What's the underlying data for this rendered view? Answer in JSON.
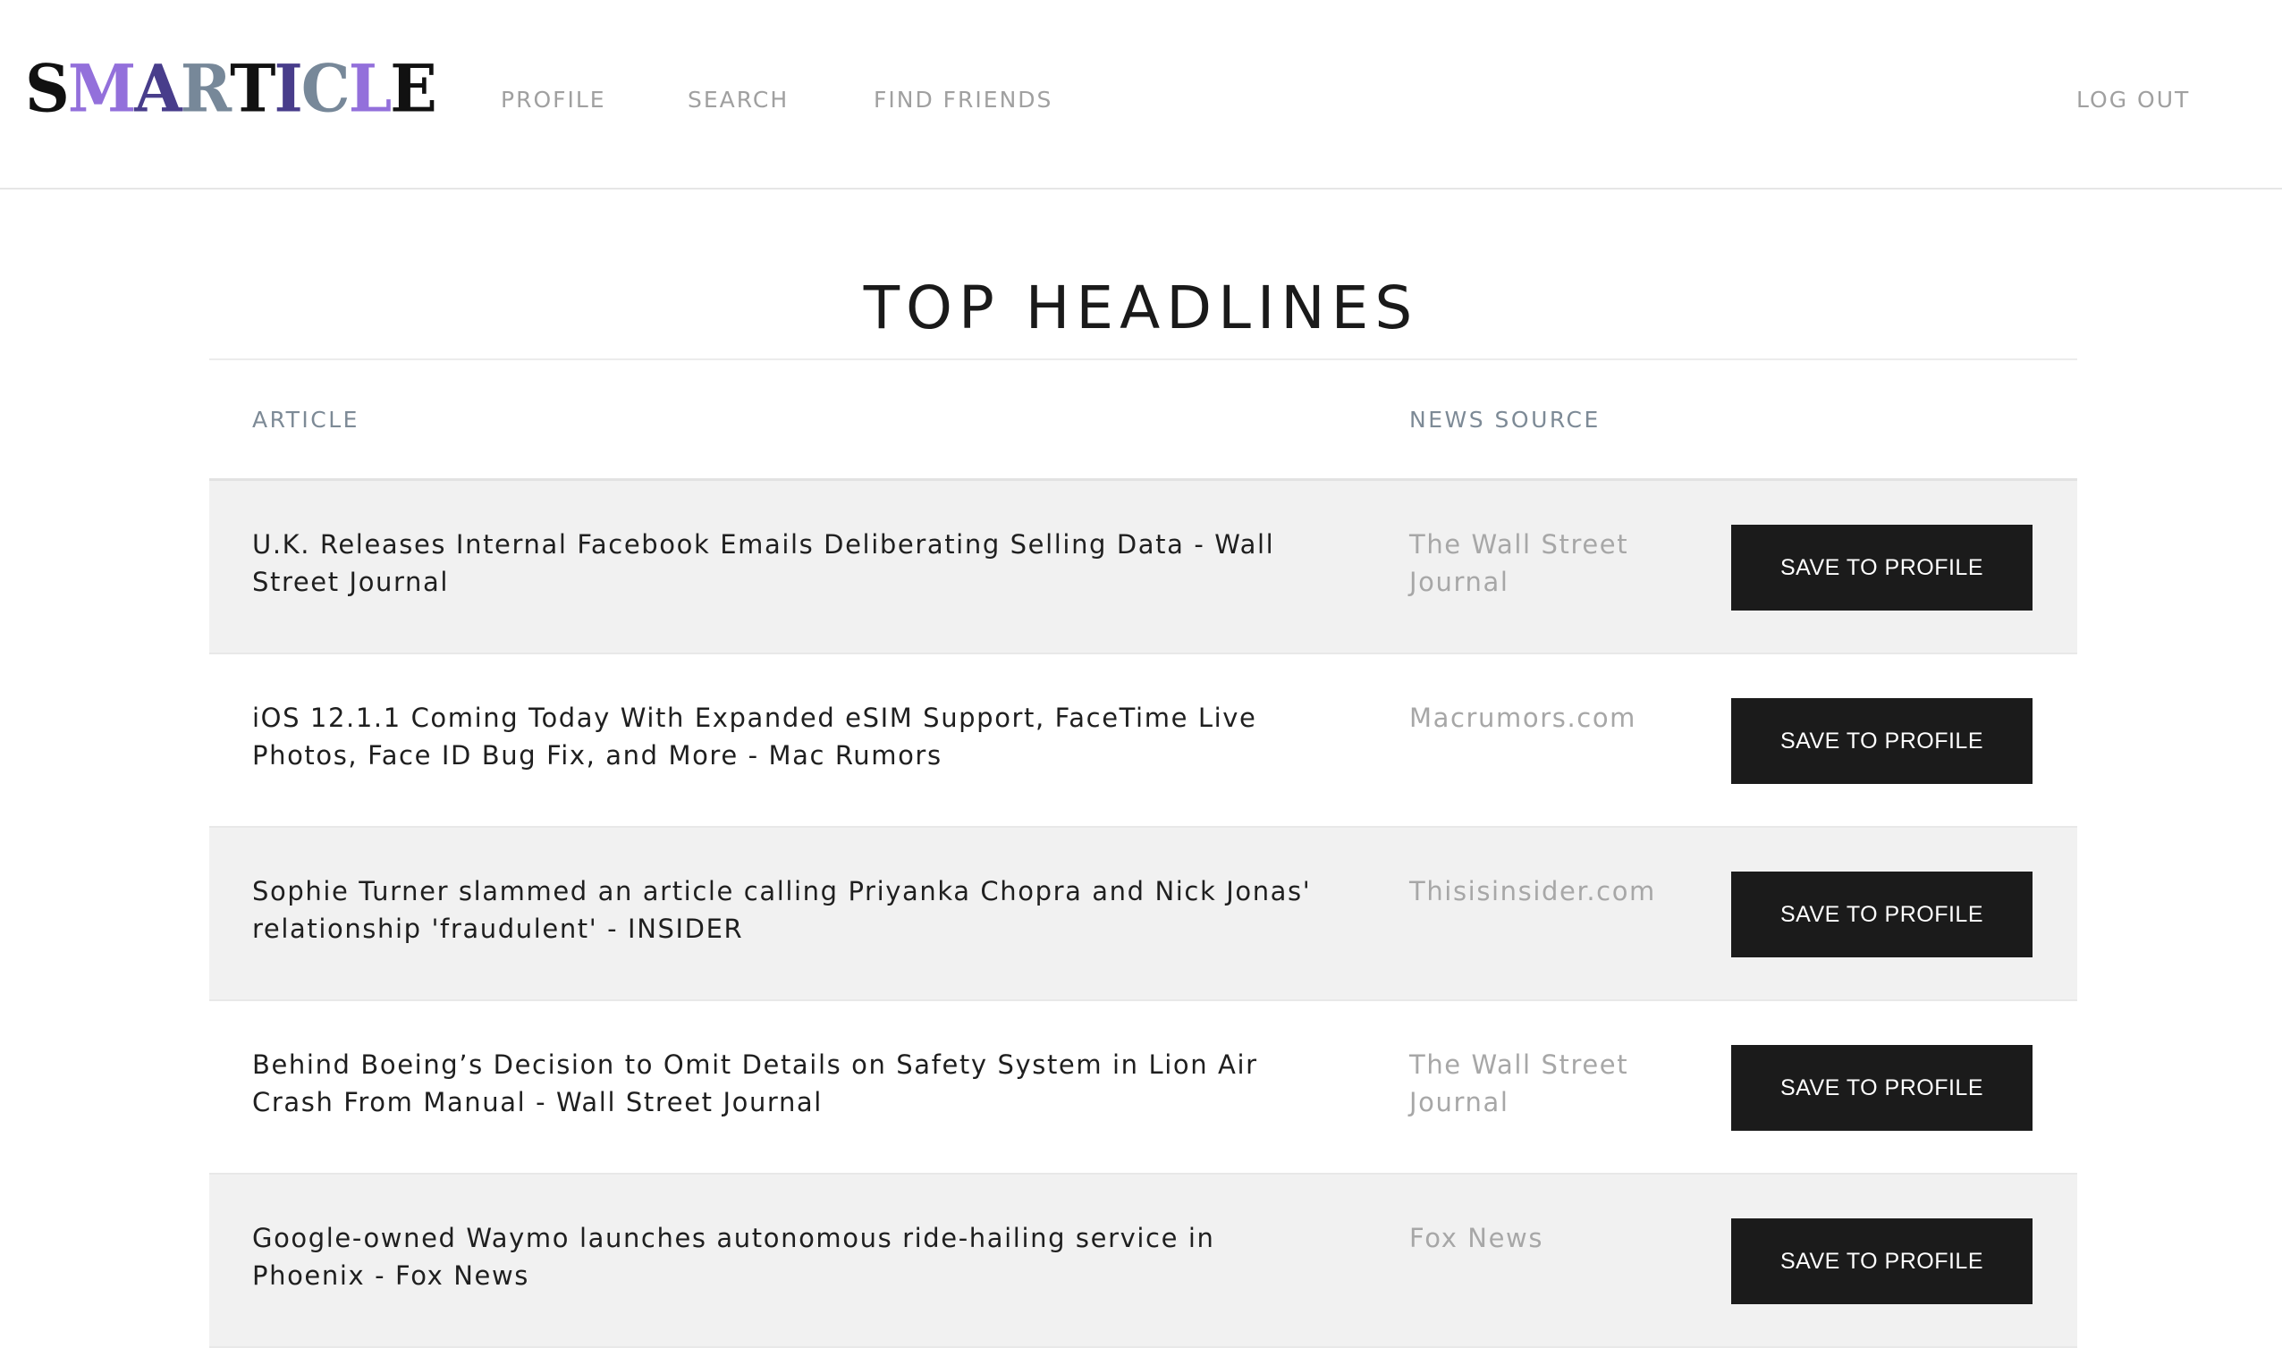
{
  "brand": {
    "logo_letters": [
      {
        "char": "S",
        "color": "#111111"
      },
      {
        "char": "M",
        "color": "#9370db"
      },
      {
        "char": "A",
        "color": "#483d8b"
      },
      {
        "char": "R",
        "color": "#778899"
      },
      {
        "char": "T",
        "color": "#111111"
      },
      {
        "char": "I",
        "color": "#483d8b"
      },
      {
        "char": "C",
        "color": "#778899"
      },
      {
        "char": "L",
        "color": "#9370db"
      },
      {
        "char": "E",
        "color": "#111111"
      }
    ]
  },
  "nav": {
    "profile": "PROFILE",
    "search": "SEARCH",
    "find_friends": "FIND FRIENDS",
    "log_out": "LOG OUT"
  },
  "main": {
    "title": "TOP HEADLINES",
    "columns": {
      "article": "ARTICLE",
      "news_source": "NEWS SOURCE"
    },
    "rows": [
      {
        "article": "U.K. Releases Internal Facebook Emails Deliberating Selling Data - Wall Street Journal",
        "source": "The Wall Street Journal",
        "action": "SAVE TO PROFILE"
      },
      {
        "article": "iOS 12.1.1 Coming Today With Expanded eSIM Support, FaceTime Live Photos, Face ID Bug Fix, and More - Mac Rumors",
        "source": "Macrumors.com",
        "action": "SAVE TO PROFILE"
      },
      {
        "article": "Sophie Turner slammed an article calling Priyanka Chopra and Nick Jonas' relationship 'fraudulent' - INSIDER",
        "source": "Thisisinsider.com",
        "action": "SAVE TO PROFILE"
      },
      {
        "article": "Behind Boeing’s Decision to Omit Details on Safety System in Lion Air Crash From Manual - Wall Street Journal",
        "source": "The Wall Street Journal",
        "action": "SAVE TO PROFILE"
      },
      {
        "article": "Google-owned Waymo launches autonomous ride-hailing service in Phoenix - Fox News",
        "source": "Fox News",
        "action": "SAVE TO PROFILE"
      }
    ]
  }
}
